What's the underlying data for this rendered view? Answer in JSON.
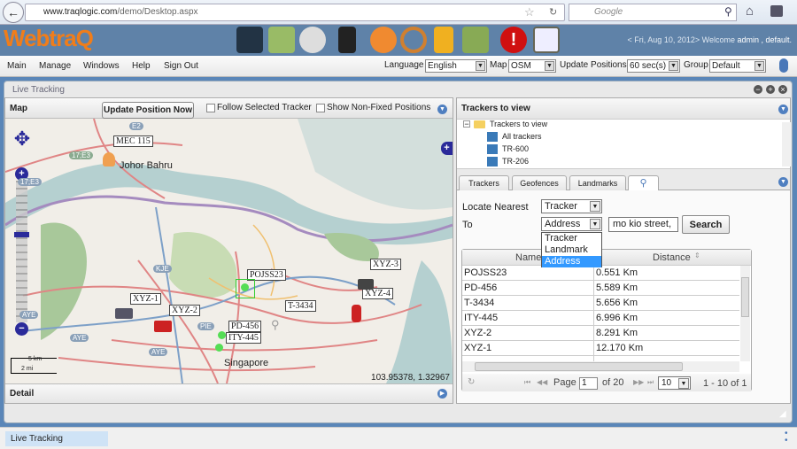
{
  "browser": {
    "url_domain": "www.traqlogic.com",
    "url_path": "/demo/Desktop.aspx",
    "search_placeholder": "Google"
  },
  "header": {
    "logo": "WebtraQ",
    "welcome_prefix": "< Fri, Aug 10, 2012> Welcome ",
    "user": "admin , default.",
    "icons": [
      "monitor-icon",
      "map-icon",
      "clock-icon",
      "mobile-icon",
      "person-icon",
      "steering-wheel-icon",
      "flag-icon",
      "geofence-map-icon",
      "alert-icon",
      "report-icon"
    ]
  },
  "menu": {
    "items": [
      "Main",
      "Manage",
      "Windows",
      "Help",
      "Sign Out"
    ],
    "language_label": "Language",
    "language": "English",
    "map_label": "Map",
    "map": "OSM",
    "update_label": "Update Positions",
    "update": "60 sec(s)",
    "group_label": "Group",
    "group": "Default"
  },
  "window": {
    "title": "Live Tracking"
  },
  "map_panel": {
    "title": "Map",
    "update_button": "Update Position Now",
    "follow_label": "Follow Selected Tracker",
    "show_nonfixed_label": "Show Non-Fixed Positions",
    "coords": "103.95378, 1.32967",
    "scale_km": "5 km",
    "scale_mi": "2 mi",
    "places": [
      "Johor Bahru",
      "Singapore"
    ],
    "markers": [
      "MEC 115",
      "POJSS23",
      "XYZ-3",
      "XYZ-4",
      "T-3434",
      "XYZ-1",
      "XYZ-2",
      "PD-456",
      "ITY-445"
    ],
    "roads": [
      "17;E3",
      "17;E3",
      "E2",
      "KJE",
      "PIE",
      "AYE",
      "AYE",
      "AYE"
    ]
  },
  "detail": {
    "title": "Detail"
  },
  "trackers": {
    "title": "Trackers to view",
    "root": "Trackers to view",
    "items": [
      "All trackers",
      "TR-600",
      "TR-206"
    ]
  },
  "tabs": [
    "Trackers",
    "Geofences",
    "Landmarks"
  ],
  "locate": {
    "label": "Locate Nearest",
    "value": "Tracker",
    "to_label": "To",
    "to_value": "Address",
    "address_value": "mo kio street,",
    "search_button": "Search",
    "options": [
      "Tracker",
      "Landmark",
      "Address"
    ],
    "selected_option": "Address"
  },
  "grid": {
    "columns": [
      "Name",
      "Distance"
    ],
    "rows": [
      [
        "POJSS23",
        "0.551 Km"
      ],
      [
        "PD-456",
        "5.589 Km"
      ],
      [
        "T-3434",
        "5.656 Km"
      ],
      [
        "ITY-445",
        "6.996 Km"
      ],
      [
        "XYZ-2",
        "8.291 Km"
      ],
      [
        "XYZ-1",
        "12.170 Km"
      ]
    ],
    "pager": {
      "page_label": "Page",
      "page": "1",
      "of": "of 20",
      "page_size": "10",
      "summary": "1 - 10 of 1"
    }
  },
  "taskbar": {
    "items": [
      "Live Tracking"
    ]
  },
  "colors": {
    "header": "#5f82a8",
    "logo": "#f07d1a",
    "desktop": "#5a86b8",
    "selection": "#3399ff"
  }
}
